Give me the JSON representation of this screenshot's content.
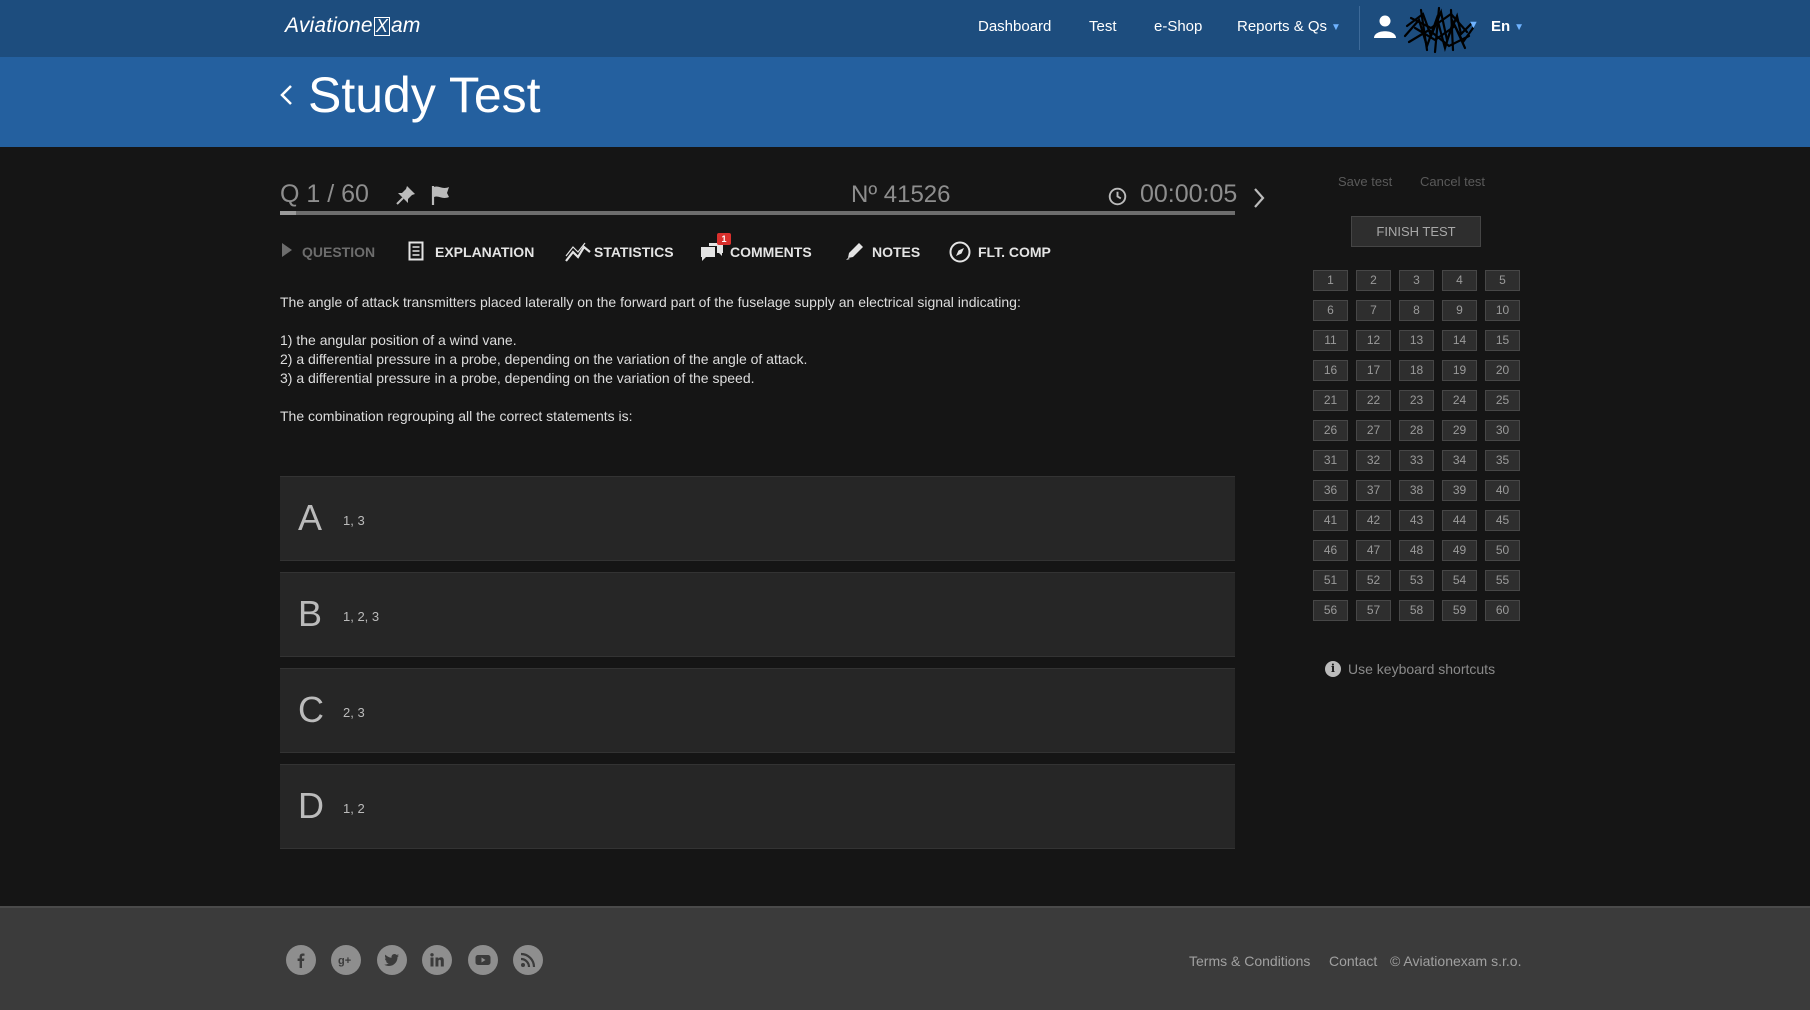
{
  "app": {
    "logo_left": "Aviatione",
    "logo_x": "X",
    "logo_right": "am"
  },
  "nav": {
    "items": [
      {
        "label": "Dashboard"
      },
      {
        "label": "Test"
      },
      {
        "label": "e-Shop"
      },
      {
        "label": "Reports & Qs"
      }
    ],
    "language": "En"
  },
  "header": {
    "title": "Study Test"
  },
  "question_header": {
    "position": "Q 1 / 60",
    "number": "Nº 41526",
    "timer": "00:00:05",
    "progress_fraction": 0.0167
  },
  "tabs": [
    {
      "label": "QUESTION",
      "icon": "play-icon",
      "active": false
    },
    {
      "label": "EXPLANATION",
      "icon": "document-icon",
      "active": true
    },
    {
      "label": "STATISTICS",
      "icon": "chart-icon",
      "active": true
    },
    {
      "label": "COMMENTS",
      "icon": "comments-icon",
      "active": true,
      "badge": "1"
    },
    {
      "label": "NOTES",
      "icon": "pencil-icon",
      "active": true
    },
    {
      "label": "FLT. COMP",
      "icon": "compass-icon",
      "active": true
    }
  ],
  "question": {
    "intro": "The angle of attack transmitters placed laterally on the forward part of the fuselage supply an electrical signal indicating:",
    "statements": [
      "1) the angular position of a wind vane.",
      "2) a differential pressure in a probe, depending on the variation of the angle of attack.",
      "3) a differential pressure in a probe, depending on the variation of the speed."
    ],
    "prompt": "The combination regrouping all the correct statements is:"
  },
  "answers": [
    {
      "letter": "A",
      "text": "1, 3"
    },
    {
      "letter": "B",
      "text": "1, 2, 3"
    },
    {
      "letter": "C",
      "text": "2, 3"
    },
    {
      "letter": "D",
      "text": "1, 2"
    }
  ],
  "sidebar": {
    "save_label": "Save test",
    "cancel_label": "Cancel test",
    "finish_label": "FINISH TEST",
    "question_count": 60,
    "shortcuts_label": "Use keyboard shortcuts"
  },
  "footer": {
    "social": [
      "facebook-icon",
      "google-plus-icon",
      "twitter-icon",
      "linkedin-icon",
      "youtube-icon",
      "rss-icon"
    ],
    "terms_label": "Terms & Conditions",
    "contact_label": "Contact",
    "copyright": "© Aviationexam s.r.o."
  },
  "colors": {
    "nav_bg": "#1d4d7e",
    "header_bg": "#24609f",
    "page_bg": "#151515",
    "footer_bg": "#3b3b3b",
    "badge": "#d9302d"
  }
}
